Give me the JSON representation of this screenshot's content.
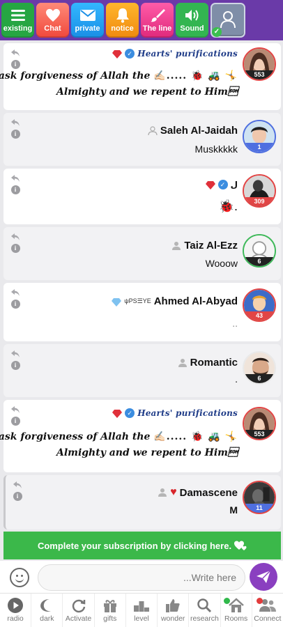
{
  "topbar": {
    "buttons": [
      {
        "label": "existing",
        "icon": "hamburger-icon"
      },
      {
        "label": "Chat",
        "icon": "heart-icon"
      },
      {
        "label": "private",
        "icon": "envelope-icon"
      },
      {
        "label": "notice",
        "icon": "bell-icon"
      },
      {
        "label": "The line",
        "icon": "brush-icon"
      },
      {
        "label": "Sound",
        "icon": "speaker-icon"
      }
    ],
    "profile_icon": "user-icon"
  },
  "messages": [
    {
      "name": "Hearts' purifications",
      "text_line1": "I ask forgiveness of Allah the",
      "text_line2": "Almighty and we repent to Him\u0001",
      "emojis": "✍🏻..... 🐞 🚜 🤸",
      "level": "553"
    },
    {
      "name": "Saleh Al-Jaidah",
      "text": "Muskkkkk",
      "level": "1"
    },
    {
      "name": "ل",
      "text": "🐞.",
      "level": "309"
    },
    {
      "name": "Taiz Al-Ezz",
      "text": "Wooow",
      "level": "6"
    },
    {
      "name": "Ahmed Al-Abyad",
      "name_suffix": "ψΡS☰YE",
      "text": "..",
      "level": "43"
    },
    {
      "name": "Romantic",
      "text": ".",
      "level": "6"
    },
    {
      "name": "Hearts' purifications",
      "text_line1": "I ask forgiveness of Allah the",
      "text_line2": "Almighty and we repent to Him\u0001",
      "emojis": "✍🏻..... 🐞 🚜 🤸",
      "level": "553"
    },
    {
      "name": "Damascene",
      "text": "M",
      "level": "11"
    }
  ],
  "banner": {
    "text": "Complete your subscription by clicking here."
  },
  "composer": {
    "placeholder": "...Write here"
  },
  "bottomnav": [
    {
      "label": "radio",
      "icon": "play-icon"
    },
    {
      "label": "dark",
      "icon": "moon-icon"
    },
    {
      "label": "Activate",
      "icon": "refresh-icon"
    },
    {
      "label": "gifts",
      "icon": "gift-icon"
    },
    {
      "label": "level",
      "icon": "podium-icon"
    },
    {
      "label": "wonder",
      "icon": "thumbs-up-icon"
    },
    {
      "label": "research",
      "icon": "search-icon"
    },
    {
      "label": "Rooms",
      "icon": "home-icon"
    },
    {
      "label": "Connect",
      "icon": "users-icon"
    }
  ],
  "colors": {
    "topbar": "#6a3aa8",
    "banner": "#3bb84a",
    "send": "#8a3fc0"
  }
}
